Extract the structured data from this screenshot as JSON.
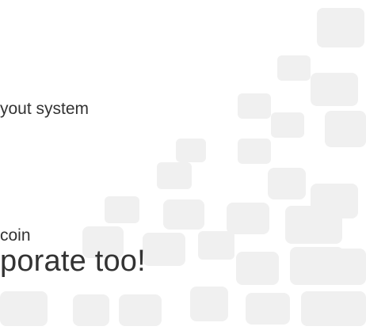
{
  "colors": {
    "background": "#ffffff",
    "text": "#333333",
    "pattern": "#f0f0f0"
  },
  "text": {
    "line_1": "yout system",
    "line_2": "coin",
    "line_3": "porate too!"
  }
}
